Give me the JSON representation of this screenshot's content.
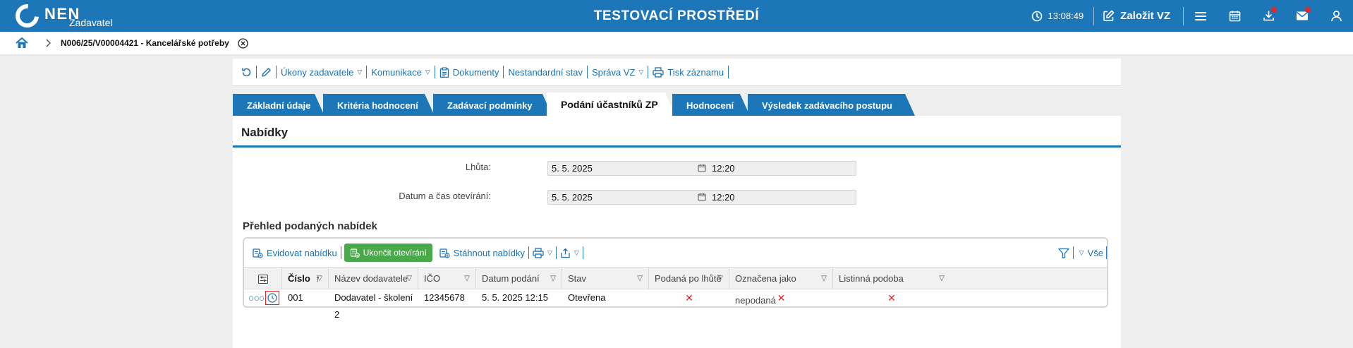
{
  "header": {
    "logo_text": "NEN",
    "logo_sub": "Zadavatel",
    "env_title": "TESTOVACÍ PROSTŘEDÍ",
    "time": "13:08:49",
    "create_label": "Založit VZ"
  },
  "breadcrumb": {
    "title": "N006/25/V00004421 - Kancelářské potřeby"
  },
  "toolbar": {
    "items": [
      "Úkony zadavatele",
      "Komunikace",
      "Dokumenty",
      "Nestandardní stav",
      "Správa VZ",
      "Tisk záznamu"
    ]
  },
  "tabs": [
    {
      "label": "Základní údaje",
      "active": false
    },
    {
      "label": "Kritéria hodnocení",
      "active": false
    },
    {
      "label": "Zadávací podmínky",
      "active": false
    },
    {
      "label": "Podání účastníků ZP",
      "active": true
    },
    {
      "label": "Hodnocení",
      "active": false
    },
    {
      "label": "Výsledek zadávacího postupu",
      "active": false
    }
  ],
  "panel": {
    "title": "Nabídky",
    "fields": [
      {
        "label": "Lhůta:",
        "date": "5. 5. 2025",
        "time": "12:20"
      },
      {
        "label": "Datum a čas otevírání:",
        "date": "5. 5. 2025",
        "time": "12:20"
      }
    ],
    "section_title": "Přehled podaných nabídek"
  },
  "grid": {
    "tools": {
      "evidovat": "Evidovat nabídku",
      "ukoncit": "Ukončit otevírání",
      "stahnout": "Stáhnout nabídky",
      "filter_all": "Vše"
    },
    "columns": [
      "Číslo",
      "Název dodavatele",
      "IČO",
      "Datum podání",
      "Stav",
      "Podaná po lhůtě",
      "Označena jako nepodaná",
      "Listinná podoba"
    ],
    "rows": [
      {
        "cislo": "001",
        "nazev": "Dodavatel - školení 2",
        "ico": "12345678",
        "datum": "5. 5. 2025 12:15",
        "stav": "Otevřena",
        "po_lhute": "✕",
        "nepodana": "✕",
        "listinna": "✕"
      }
    ]
  },
  "colors": {
    "brand_blue": "#1c76b8",
    "green": "#48a84a",
    "red": "#e4262a"
  }
}
